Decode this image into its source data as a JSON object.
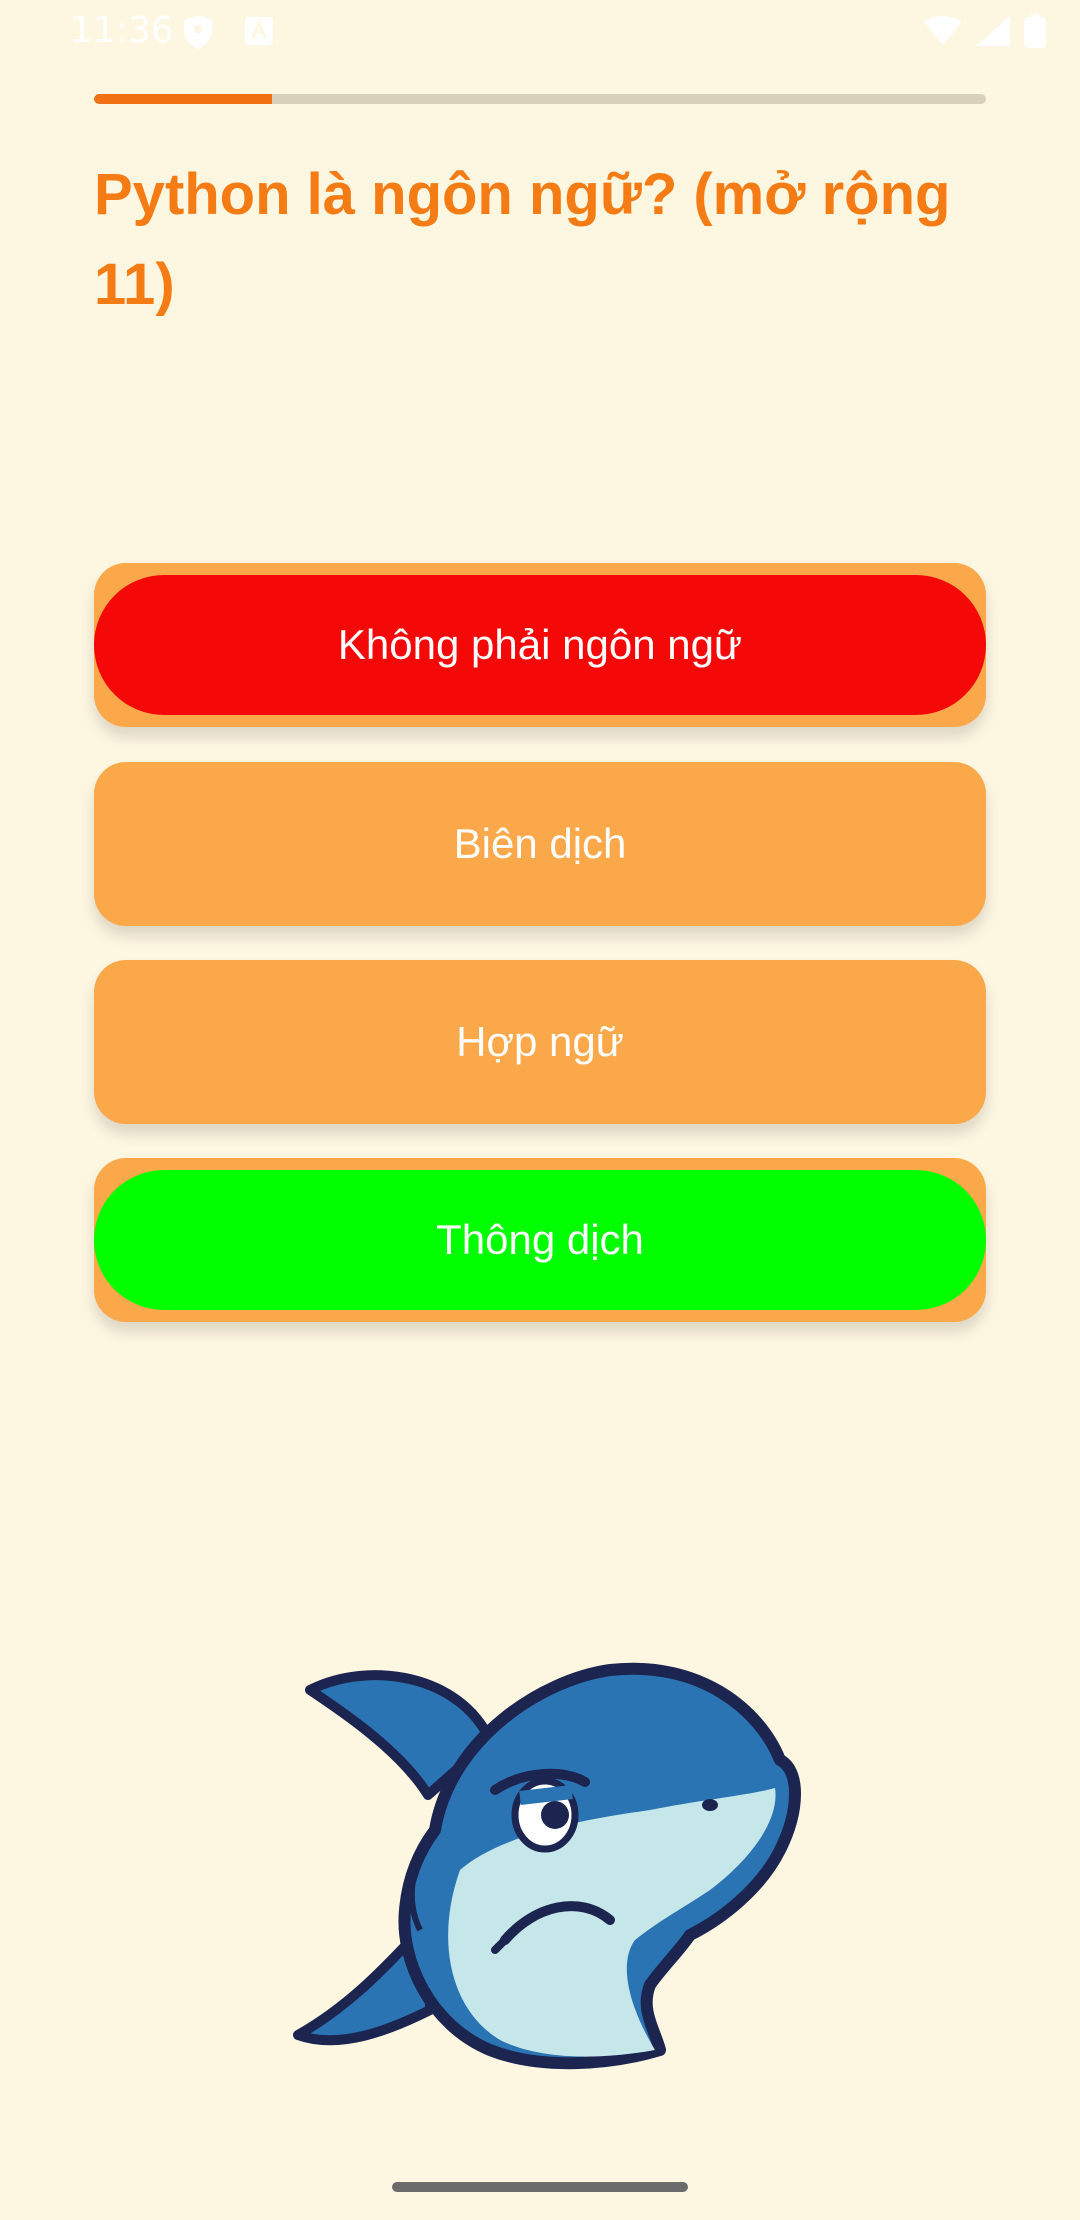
{
  "status_bar": {
    "time": "11:36",
    "icons": [
      "shield-icon",
      "app-a-icon",
      "wifi-icon",
      "signal-icon",
      "battery-icon"
    ]
  },
  "quiz": {
    "progress": 0.2,
    "question": "Python là ngôn ngữ? (mở rộng 11)",
    "answers": [
      {
        "label": "Không phải ngôn ngữ",
        "state": "wrong",
        "color": "#f50808"
      },
      {
        "label": "Biên dịch",
        "state": "neutral",
        "color": "#fba84a"
      },
      {
        "label": "Hợp ngữ",
        "state": "neutral",
        "color": "#fba84a"
      },
      {
        "label": "Thông dịch",
        "state": "correct",
        "color": "#00ff00"
      }
    ]
  },
  "mascot": {
    "icon": "shark-mascot-icon",
    "mood": "sad"
  },
  "colors": {
    "background": "#fdf6e1",
    "accent": "#f57c14",
    "card": "#fba84a",
    "wrong": "#f50808",
    "correct": "#00ff00"
  }
}
